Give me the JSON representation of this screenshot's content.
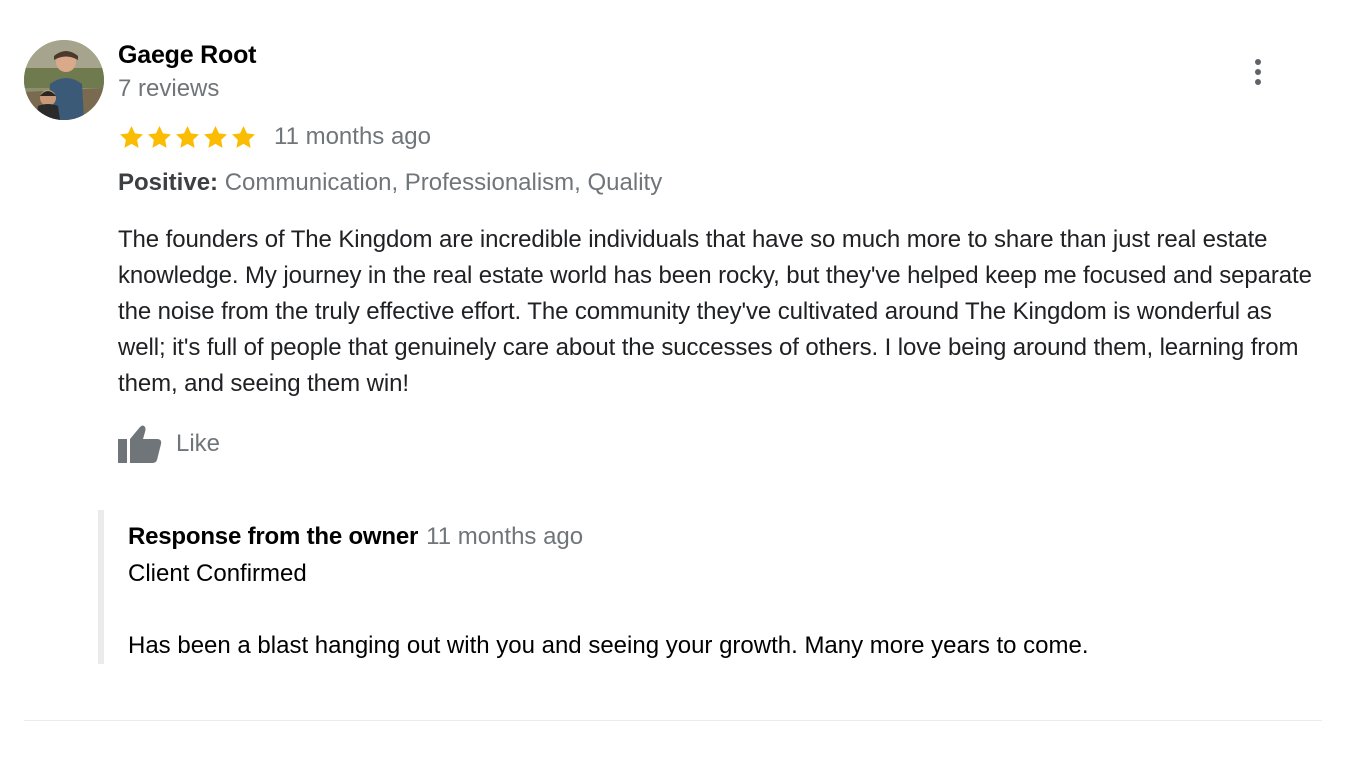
{
  "review": {
    "author": {
      "name": "Gaege Root",
      "review_count": "7 reviews",
      "avatar": "user-photo"
    },
    "rating": 5,
    "rating_max": 5,
    "date": "11 months ago",
    "highlights": {
      "label": "Positive:",
      "values": "Communication, Professionalism, Quality"
    },
    "text": "The founders of The Kingdom are incredible individuals that have so much more to share than just real estate knowledge. My journey in the real estate world has been rocky, but they've helped keep me focused and separate the noise from the truly effective effort. The community they've cultivated around The Kingdom is wonderful as well; it's full of people that genuinely care about the successes of others. I love being around them, learning from them, and seeing them win!",
    "like": {
      "label": "Like",
      "icon": "thumbs-up-icon"
    },
    "menu_icon": "more-vert-icon"
  },
  "owner_response": {
    "title": "Response from the owner",
    "date": "11 months ago",
    "text": "Client Confirmed\n\nHas been a blast hanging out with you and seeing your growth. Many more years to come."
  },
  "colors": {
    "star": "#fbbc04",
    "secondary_text": "#70757a",
    "icon_gray": "#5f6368",
    "response_bar": "#ebebeb"
  }
}
